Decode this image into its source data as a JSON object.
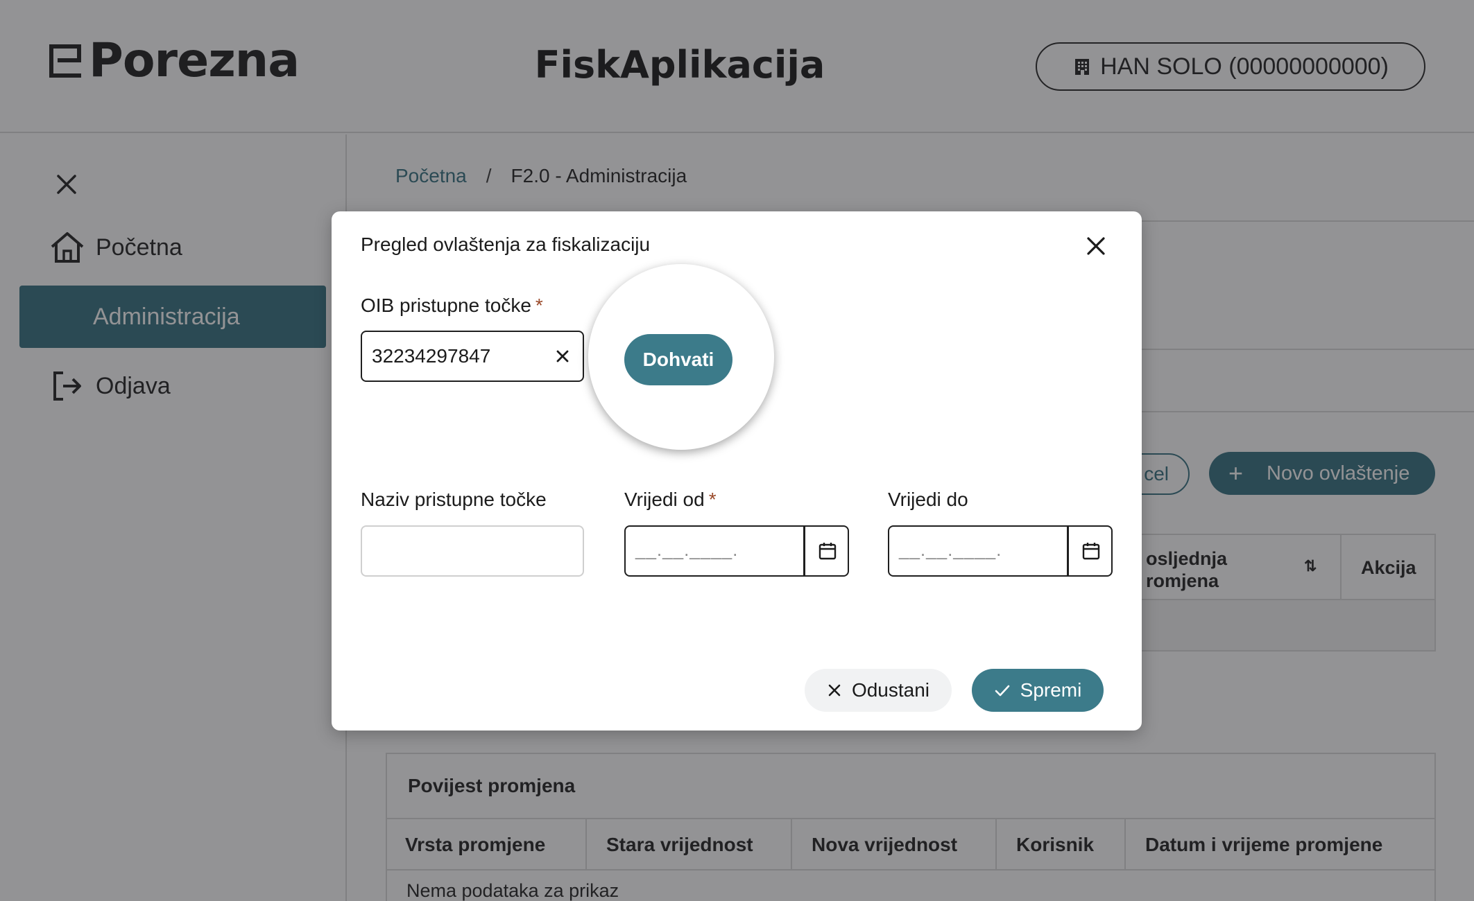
{
  "header": {
    "logo_text": "Porezna",
    "app_title": "FiskAplikacija",
    "user_label": "HAN SOLO (00000000000)"
  },
  "sidebar": {
    "items": [
      {
        "label": "Početna",
        "icon": "home-icon"
      },
      {
        "label": "Administracija",
        "icon": ""
      },
      {
        "label": "Odjava",
        "icon": "logout-icon"
      }
    ]
  },
  "breadcrumb": {
    "home": "Početna",
    "separator": "/",
    "current": "F2.0 - Administracija"
  },
  "background": {
    "excel_label": "cel",
    "new_plus": "+",
    "new_label": "Novo ovlaštenje",
    "table_col_last_change_1": "osljednja",
    "table_col_last_change_2": "romjena",
    "sort_glyph": "⇅",
    "table_col_action": "Akcija"
  },
  "history": {
    "title": "Povijest promjena",
    "columns": [
      "Vrsta promjene",
      "Stara vrijednost",
      "Nova vrijednost",
      "Korisnik",
      "Datum i vrijeme promjene"
    ],
    "empty_text": "Nema podataka za prikaz"
  },
  "modal": {
    "title": "Pregled ovlaštenja za fiskalizaciju",
    "oib_label": "OIB pristupne točke",
    "required_mark": "*",
    "oib_value": "32234297847",
    "fetch_label": "Dohvati",
    "name_label": "Naziv pristupne točke",
    "name_value": "",
    "valid_from_label": "Vrijedi od",
    "valid_to_label": "Vrijedi do",
    "date_mask": "__.__.____.",
    "cancel_label": "Odustani",
    "save_label": "Spremi"
  },
  "colors": {
    "accent": "#2e6c7c",
    "button": "#3c7b8a",
    "required": "#9a4a2a"
  }
}
